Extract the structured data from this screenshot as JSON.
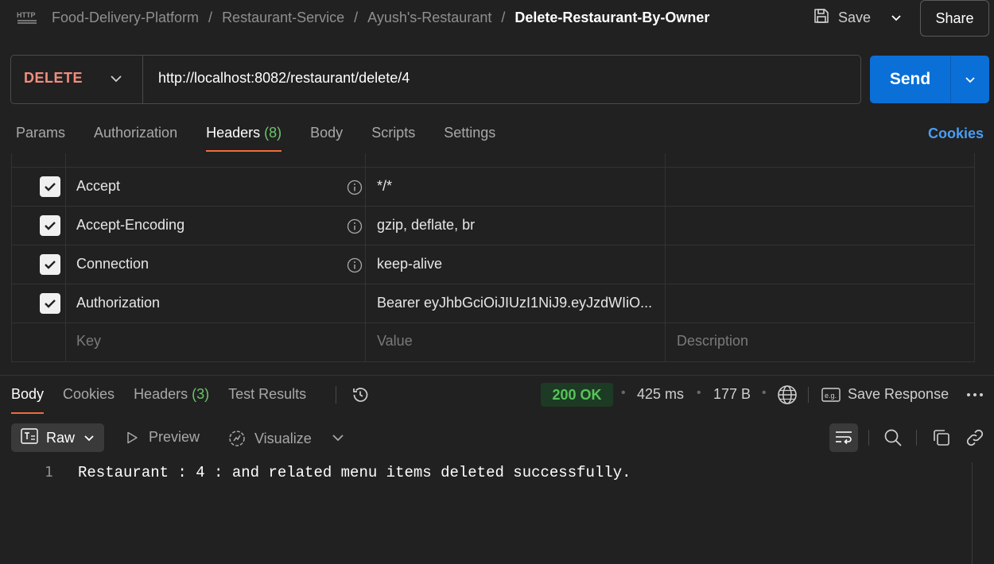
{
  "breadcrumb": {
    "items": [
      "Food-Delivery-Platform",
      "Restaurant-Service",
      "Ayush's-Restaurant"
    ],
    "current": "Delete-Restaurant-By-Owner"
  },
  "toolbar": {
    "save_label": "Save",
    "share_label": "Share"
  },
  "request": {
    "method": "DELETE",
    "url": "http://localhost:8082/restaurant/delete/4",
    "send_label": "Send"
  },
  "request_tabs": {
    "params": "Params",
    "authorization": "Authorization",
    "headers": "Headers",
    "headers_count": "(8)",
    "body": "Body",
    "scripts": "Scripts",
    "settings": "Settings",
    "cookies": "Cookies"
  },
  "headers_table": {
    "rows": [
      {
        "key": "Accept",
        "value": "*/*",
        "checked": true
      },
      {
        "key": "Accept-Encoding",
        "value": "gzip, deflate, br",
        "checked": true
      },
      {
        "key": "Connection",
        "value": "keep-alive",
        "checked": true
      },
      {
        "key": "Authorization",
        "value": "Bearer eyJhbGciOiJIUzI1NiJ9.eyJzdWIiO...",
        "checked": true
      }
    ],
    "placeholders": {
      "key": "Key",
      "value": "Value",
      "description": "Description"
    }
  },
  "response_tabs": {
    "body": "Body",
    "cookies": "Cookies",
    "headers": "Headers",
    "headers_count": "(3)",
    "test_results": "Test Results"
  },
  "response_meta": {
    "status": "200 OK",
    "time": "425 ms",
    "size": "177 B",
    "save_response": "Save Response"
  },
  "response_toolbar": {
    "raw": "Raw",
    "preview": "Preview",
    "visualize": "Visualize"
  },
  "response_body": {
    "line_number": "1",
    "text": "Restaurant : 4 : and related menu items deleted successfully."
  },
  "colors": {
    "accent": "#0b6fd8",
    "method": "#f08d7f",
    "status_ok": "#58c35a",
    "active_tab": "#f26b3a",
    "link": "#4a9df0"
  }
}
